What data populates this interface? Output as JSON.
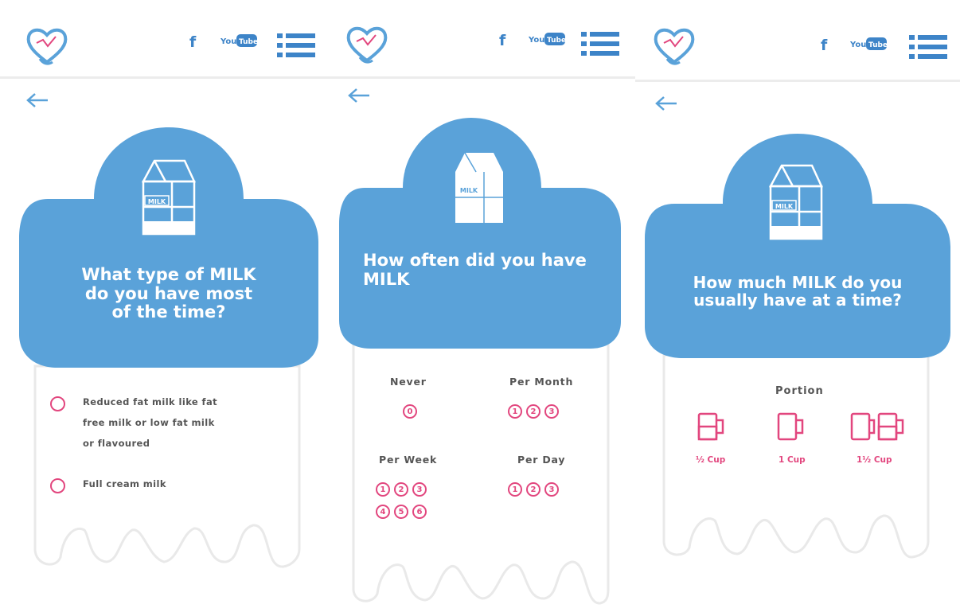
{
  "brand": {
    "color": "#5aa2d9",
    "accent": "#e2467e"
  },
  "header": {
    "facebook_label": "f",
    "youtube_label": "YouTube",
    "icons": [
      "heart-logo-icon",
      "facebook-icon",
      "youtube-icon",
      "menu-icon"
    ]
  },
  "carton_label": "MILK",
  "screens": [
    {
      "question": [
        "What type of MILK",
        "do you have most",
        "of the time?"
      ],
      "options": [
        {
          "label": [
            "Reduced fat milk like fat",
            "free milk or low fat milk",
            "or flavoured"
          ]
        },
        {
          "label": [
            "Full cream milk"
          ]
        }
      ]
    },
    {
      "question": [
        "How often did you have",
        "MILK"
      ],
      "groups": [
        {
          "label": "Never",
          "values": [
            "0"
          ]
        },
        {
          "label": "Per Month",
          "values": [
            "1",
            "2",
            "3"
          ]
        },
        {
          "label": "Per Week",
          "values": [
            "1",
            "2",
            "3",
            "4",
            "5",
            "6"
          ]
        },
        {
          "label": "Per Day",
          "values": [
            "1",
            "2",
            "3"
          ]
        }
      ]
    },
    {
      "question": [
        "How much MILK do you",
        "usually have at a time?"
      ],
      "portion_title": "Portion",
      "portions": [
        {
          "label": "½ Cup"
        },
        {
          "label": "1 Cup"
        },
        {
          "label": "1½ Cup"
        }
      ]
    }
  ]
}
